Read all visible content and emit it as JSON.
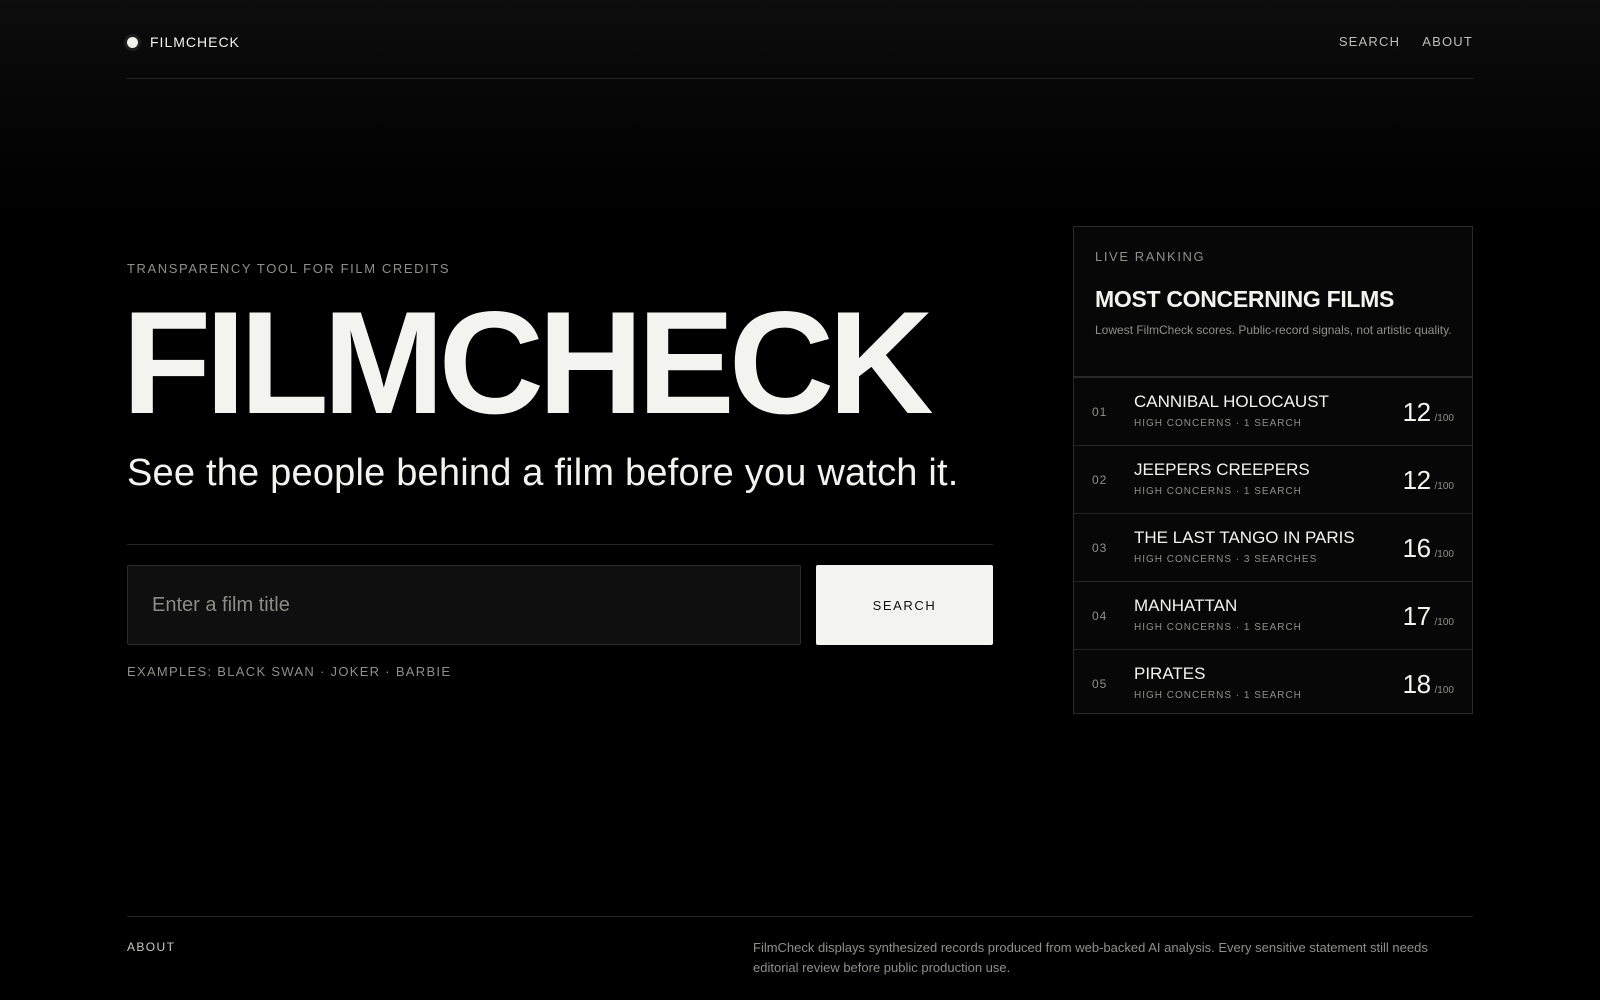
{
  "header": {
    "brand": "FILMCHECK",
    "nav": {
      "search": "SEARCH",
      "about": "ABOUT"
    }
  },
  "hero": {
    "eyebrow": "TRANSPARENCY TOOL FOR FILM CREDITS",
    "title": "FILMCHECK",
    "tagline": "See the people behind a film before you watch it.",
    "search": {
      "placeholder": "Enter a film title",
      "value": "",
      "button_label": "SEARCH"
    },
    "examples": "EXAMPLES: BLACK SWAN · JOKER · BARBIE"
  },
  "ranking": {
    "eyebrow": "LIVE RANKING",
    "title": "MOST CONCERNING FILMS",
    "description": "Lowest FilmCheck scores. Public-record signals, not artistic quality.",
    "items": [
      {
        "rank": "01",
        "title": "CANNIBAL HOLOCAUST",
        "meta": "HIGH CONCERNS · 1 SEARCH",
        "score": "12",
        "max": "/100"
      },
      {
        "rank": "02",
        "title": "JEEPERS CREEPERS",
        "meta": "HIGH CONCERNS · 1 SEARCH",
        "score": "12",
        "max": "/100"
      },
      {
        "rank": "03",
        "title": "THE LAST TANGO IN PARIS",
        "meta": "HIGH CONCERNS · 3 SEARCHES",
        "score": "16",
        "max": "/100"
      },
      {
        "rank": "04",
        "title": "MANHATTAN",
        "meta": "HIGH CONCERNS · 1 SEARCH",
        "score": "17",
        "max": "/100"
      },
      {
        "rank": "05",
        "title": "PIRATES",
        "meta": "HIGH CONCERNS · 1 SEARCH",
        "score": "18",
        "max": "/100"
      }
    ]
  },
  "footer": {
    "label": "ABOUT",
    "text": "FilmCheck displays synthesized records produced from web-backed AI analysis. Every sensitive statement still needs editorial review before public production use."
  },
  "colors": {
    "background": "#000000",
    "foreground": "#f2f2ef",
    "muted": "#8f8f8b",
    "border": "#2a2a2a",
    "button_bg": "#f3f3f0"
  },
  "icons": {
    "brand": "dot-logo-icon"
  }
}
